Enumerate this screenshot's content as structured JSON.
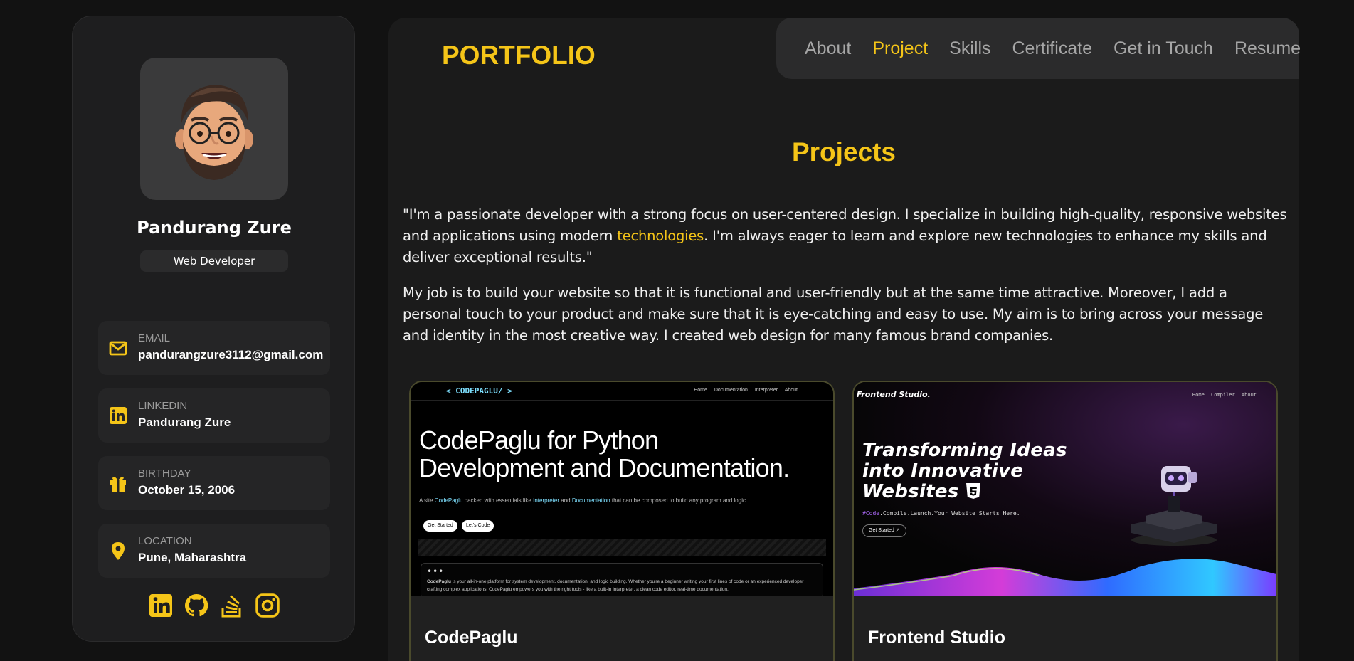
{
  "profile": {
    "name": "Pandurang Zure",
    "role": "Web Developer"
  },
  "contacts": [
    {
      "title": "EMAIL",
      "value": "pandurangzure3112@gmail.com",
      "icon": "mail-icon"
    },
    {
      "title": "LINKEDIN",
      "value": "Pandurang Zure",
      "icon": "linkedin-icon"
    },
    {
      "title": "BIRTHDAY",
      "value": "October 15, 2006",
      "icon": "gift-icon"
    },
    {
      "title": "LOCATION",
      "value": "Pune, Maharashtra",
      "icon": "location-pin-icon"
    }
  ],
  "socials": [
    "linkedin-icon",
    "github-icon",
    "stackoverflow-icon",
    "instagram-icon"
  ],
  "header": {
    "logo": "PORTFOLIO",
    "nav": [
      "About",
      "Project",
      "Skills",
      "Certificate",
      "Get in Touch",
      "Resume"
    ],
    "active": "Project"
  },
  "projects_section": {
    "title": "Projects",
    "para1_a": "\"I'm a passionate developer with a strong focus on user-centered design. I specialize in building high-quality, responsive websites and applications using modern ",
    "para1_highlight": "technologies",
    "para1_b": ". I'm always eager to learn and explore new technologies to enhance my skills and deliver exceptional results.\"",
    "para2": "My job is to build your website so that it is functional and user-friendly but at the same time attractive. Moreover, I add a personal touch to your product and make sure that it is eye-catching and easy to use. My aim is to bring across your message and identity in the most creative way. I created web design for many famous brand companies."
  },
  "projects": [
    {
      "title": "CodePaglu",
      "preview": {
        "brand": "< CODEPAGLU/ >",
        "nav": "Home Documentation Interpreter About",
        "headline_1": "CodePaglu for Python",
        "headline_2": "Development and Documentation.",
        "sub_a": "A site ",
        "sub_link1": "CodePaglu",
        "sub_b": " packed with essentials like ",
        "sub_link2": "Interpreter",
        "sub_c": " and ",
        "sub_link3": "Documentation",
        "sub_d": " that can be composed to build any program and logic.",
        "btn1": "Get Started",
        "btn2": "Let's Code",
        "dots": "•••",
        "body_bold": "CodePaglu",
        "body": " is your all-in-one platform for system development, documentation, and logic building. Whether you're a beginner writing your first lines of code or an experienced developer crafting complex applications, CodePaglu empowers you with the right tools - like a built-in interpreter, a clean code editor, real-time documentation,"
      }
    },
    {
      "title": "Frontend Studio",
      "preview": {
        "brand": "Frontend Studio.",
        "nav": "Home Compiler About",
        "headline_1": "Transforming Ideas",
        "headline_2": "into Innovative",
        "headline_3": "Websites",
        "tag_hl": "#Code",
        "tag": ".Compile.Launch.Your Website Starts Here.",
        "btn": "Get Started ↗"
      }
    }
  ],
  "colors": {
    "accent": "#f5c518",
    "background": "#121212",
    "panel": "#1e1e1f"
  }
}
